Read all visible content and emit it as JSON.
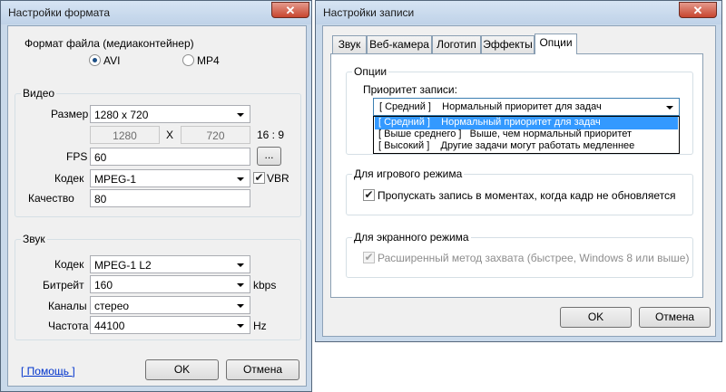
{
  "format_dialog": {
    "title": "Настройки формата",
    "close_glyph": "✕",
    "container_label": "Формат файла (медиаконтейнер)",
    "format_options": [
      "AVI",
      "MP4"
    ],
    "selected_format": "AVI",
    "video": {
      "group_label": "Видео",
      "size_label": "Размер",
      "size_value": "1280 x 720",
      "width_value": "1280",
      "times_sign": "X",
      "height_value": "720",
      "aspect": "16 : 9",
      "fps_label": "FPS",
      "fps_value": "60",
      "fps_button": "...",
      "codec_label": "Кодек",
      "codec_value": "MPEG-1",
      "vbr_label": "VBR",
      "vbr_checked": true,
      "quality_label": "Качество",
      "quality_value": "80"
    },
    "audio": {
      "group_label": "Звук",
      "codec_label": "Кодек",
      "codec_value": "MPEG-1 L2",
      "bitrate_label": "Битрейт",
      "bitrate_value": "160",
      "bitrate_unit": "kbps",
      "channels_label": "Каналы",
      "channels_value": "стерео",
      "freq_label": "Частота",
      "freq_value": "44100",
      "freq_unit": "Hz"
    },
    "help_link": "[ Помощь ]",
    "ok_label": "OK",
    "cancel_label": "Отмена"
  },
  "record_dialog": {
    "title": "Настройки записи",
    "close_glyph": "✕",
    "tabs": [
      "Звук",
      "Веб-камера",
      "Логотип",
      "Эффекты",
      "Опции"
    ],
    "active_tab": "Опции",
    "options_group": "Опции",
    "priority_label": "Приоритет записи:",
    "priority_selected": "[ Средний ]    Нормальный приоритет для задач",
    "priority_options": [
      "[ Средний ]    Нормальный приоритет для задач",
      "[ Выше среднего ]   Выше, чем нормальный приоритет",
      "[ Высокий ]    Другие задачи могут работать медленнее"
    ],
    "game_group": "Для игрового режима",
    "skip_frames_label": "Пропускать запись в моментах, когда кадр не обновляется",
    "skip_frames_checked": true,
    "screen_group": "Для экранного режима",
    "capture_method_label": "Расширенный метод захвата (быстрее, Windows 8 или выше)",
    "capture_method_checked": true,
    "ok_label": "OK",
    "cancel_label": "Отмена"
  }
}
